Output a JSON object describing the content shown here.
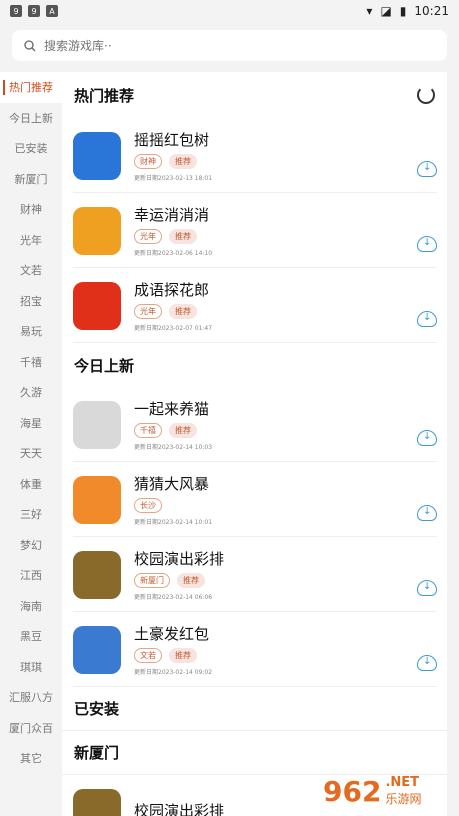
{
  "status_bar": {
    "left_icons": [
      "9",
      "9",
      "A"
    ],
    "time": "10:21"
  },
  "search": {
    "placeholder": "搜索游戏库··"
  },
  "sidebar": [
    {
      "label": "热门推荐",
      "active": true
    },
    {
      "label": "今日上新"
    },
    {
      "label": "已安装"
    },
    {
      "label": "新厦门"
    },
    {
      "label": "财神"
    },
    {
      "label": "光年"
    },
    {
      "label": "文若"
    },
    {
      "label": "招宝"
    },
    {
      "label": "易玩"
    },
    {
      "label": "千禧"
    },
    {
      "label": "久游"
    },
    {
      "label": "海星"
    },
    {
      "label": "天天"
    },
    {
      "label": "体重"
    },
    {
      "label": "三好"
    },
    {
      "label": "梦幻"
    },
    {
      "label": "江西"
    },
    {
      "label": "海南"
    },
    {
      "label": "黑豆"
    },
    {
      "label": "琪琪"
    },
    {
      "label": "汇服八方"
    },
    {
      "label": "厦门众百"
    },
    {
      "label": "其它"
    }
  ],
  "sections": {
    "hot": {
      "title": "热门推荐",
      "games": [
        {
          "name": "摇摇红包树",
          "tags": [
            "财神",
            "推荐"
          ],
          "date": "更新日期2023-02-13 18:01",
          "color": "#2a76d8"
        },
        {
          "name": "幸运消消消",
          "tags": [
            "光年",
            "推荐"
          ],
          "date": "更新日期2023-02-06 14:10",
          "color": "#f0a020"
        },
        {
          "name": "成语探花郎",
          "tags": [
            "光年",
            "推荐"
          ],
          "date": "更新日期2023-02-07 01:47",
          "color": "#e0301a"
        }
      ]
    },
    "new": {
      "title": "今日上新",
      "games": [
        {
          "name": "一起来养猫",
          "tags": [
            "千禧",
            "推荐"
          ],
          "date": "更新日期2023-02-14 10:03",
          "color": "#d9d9d9"
        },
        {
          "name": "猜猜大风暴",
          "tags": [
            "长沙"
          ],
          "date": "更新日期2023-02-14 10:01",
          "color": "#f08a2a"
        },
        {
          "name": "校园演出彩排",
          "tags": [
            "新厦门",
            "推荐"
          ],
          "date": "更新日期2023-02-14 06:06",
          "color": "#8a6a2a"
        },
        {
          "name": "土豪发红包",
          "tags": [
            "文若",
            "推荐"
          ],
          "date": "更新日期2023-02-14 09:02",
          "color": "#3a7ad0"
        }
      ]
    },
    "installed": {
      "title": "已安装"
    },
    "xiamen": {
      "title": "新厦门",
      "games": [
        {
          "name": "校园演出彩排",
          "color": "#8a6a2a"
        }
      ]
    }
  },
  "watermark": {
    "number": "962",
    "net": ".NET",
    "cn": "乐游网"
  }
}
